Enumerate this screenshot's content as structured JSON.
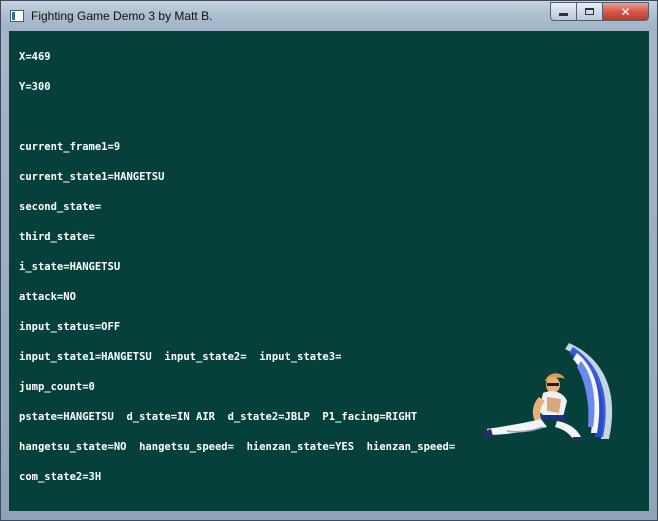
{
  "window": {
    "title": "Fighting Game Demo 3 by Matt B.",
    "icon": "app-icon",
    "buttons": {
      "minimize": "minimize-icon",
      "maximize": "maximize-icon",
      "close": "close-icon"
    }
  },
  "game": {
    "background_color": "#06403a",
    "text_color": "#ffffff",
    "debug": {
      "x_line": "X=469",
      "y_line": "Y=300",
      "current_frame1": "current_frame1=9",
      "current_state1": "current_state1=HANGETSU",
      "second_state": "second_state=",
      "third_state": "third_state=",
      "i_state": "i_state=HANGETSU",
      "attack": "attack=NO",
      "input_status": "input_status=OFF",
      "input_states": "input_state1=HANGETSU  input_state2=  input_state3=",
      "jump_count": "jump_count=0",
      "pstate_line": "pstate=HANGETSU  d_state=IN AIR  d_state2=JBLP  P1_facing=RIGHT",
      "hangetsu_line": "hangetsu_state=NO  hangetsu_speed=  hienzan_state=YES  hienzan_speed=",
      "com_state2": "com_state2=3H"
    },
    "sprite": "fighter-sprite"
  }
}
